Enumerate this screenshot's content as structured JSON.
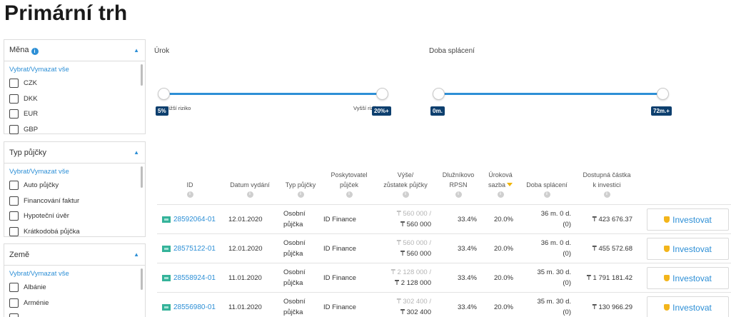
{
  "page": {
    "title": "Primární trh"
  },
  "filters": {
    "currency": {
      "title": "Měna",
      "select_all": "Vybrat/Vymazat vše",
      "options": [
        "CZK",
        "DKK",
        "EUR",
        "GBP"
      ]
    },
    "loan_type": {
      "title": "Typ půjčky",
      "select_all": "Vybrat/Vymazat vše",
      "options": [
        "Auto půjčky",
        "Financování faktur",
        "Hypoteční úvěr",
        "Krátkodobá půjčka"
      ]
    },
    "country": {
      "title": "Země",
      "select_all": "Vybrat/Vymazat vše",
      "options": [
        "Albánie",
        "Arménie"
      ]
    }
  },
  "sliders": {
    "interest": {
      "label": "Úrok",
      "min_tag": "5%",
      "max_tag": "20%+",
      "low_risk": "Nižší riziko",
      "high_risk": "Vyšší riziko"
    },
    "term": {
      "label": "Doba splácení",
      "min_tag": "0m.",
      "max_tag": "72m.+"
    }
  },
  "table": {
    "headers": {
      "id": "ID",
      "issue_date": "Datum vydání",
      "loan_type": "Typ půjčky",
      "originator": [
        "Poskytovatel",
        "půjček"
      ],
      "amount": [
        "Výše/",
        "zůstatek půjčky"
      ],
      "rpsn": [
        "Dlužníkovo",
        "RPSN"
      ],
      "rate": [
        "Úroková",
        "sazba"
      ],
      "term": "Doba splácení",
      "available": [
        "Dostupná částka",
        "k investici"
      ]
    },
    "info_glyph": "i",
    "invest_label": "Investovat",
    "rows": [
      {
        "id": "28592064-01",
        "date": "12.01.2020",
        "type": [
          "Osobní",
          "půjčka"
        ],
        "originator": "ID Finance",
        "amount": "₸ 560 000 /",
        "remaining": "₸ 560 000",
        "rpsn": "33.4%",
        "rate": "20.0%",
        "term": [
          "36 m. 0 d.",
          "(0)"
        ],
        "available": "₸ 423 676.37"
      },
      {
        "id": "28575122-01",
        "date": "12.01.2020",
        "type": [
          "Osobní",
          "půjčka"
        ],
        "originator": "ID Finance",
        "amount": "₸ 560 000 /",
        "remaining": "₸ 560 000",
        "rpsn": "33.4%",
        "rate": "20.0%",
        "term": [
          "36 m. 0 d.",
          "(0)"
        ],
        "available": "₸ 455 572.68"
      },
      {
        "id": "28558924-01",
        "date": "11.01.2020",
        "type": [
          "Osobní",
          "půjčka"
        ],
        "originator": "ID Finance",
        "amount": "₸ 2 128 000 /",
        "remaining": "₸ 2 128 000",
        "rpsn": "33.4%",
        "rate": "20.0%",
        "term": [
          "35 m. 30 d.",
          "(0)"
        ],
        "available": "₸ 1 791 181.42"
      },
      {
        "id": "28556980-01",
        "date": "11.01.2020",
        "type": [
          "Osobní",
          "půjčka"
        ],
        "originator": "ID Finance",
        "amount": "₸ 302 400 /",
        "remaining": "₸ 302 400",
        "rpsn": "33.4%",
        "rate": "20.0%",
        "term": [
          "35 m. 30 d.",
          "(0)"
        ],
        "available": "₸ 130 966.29"
      }
    ]
  }
}
